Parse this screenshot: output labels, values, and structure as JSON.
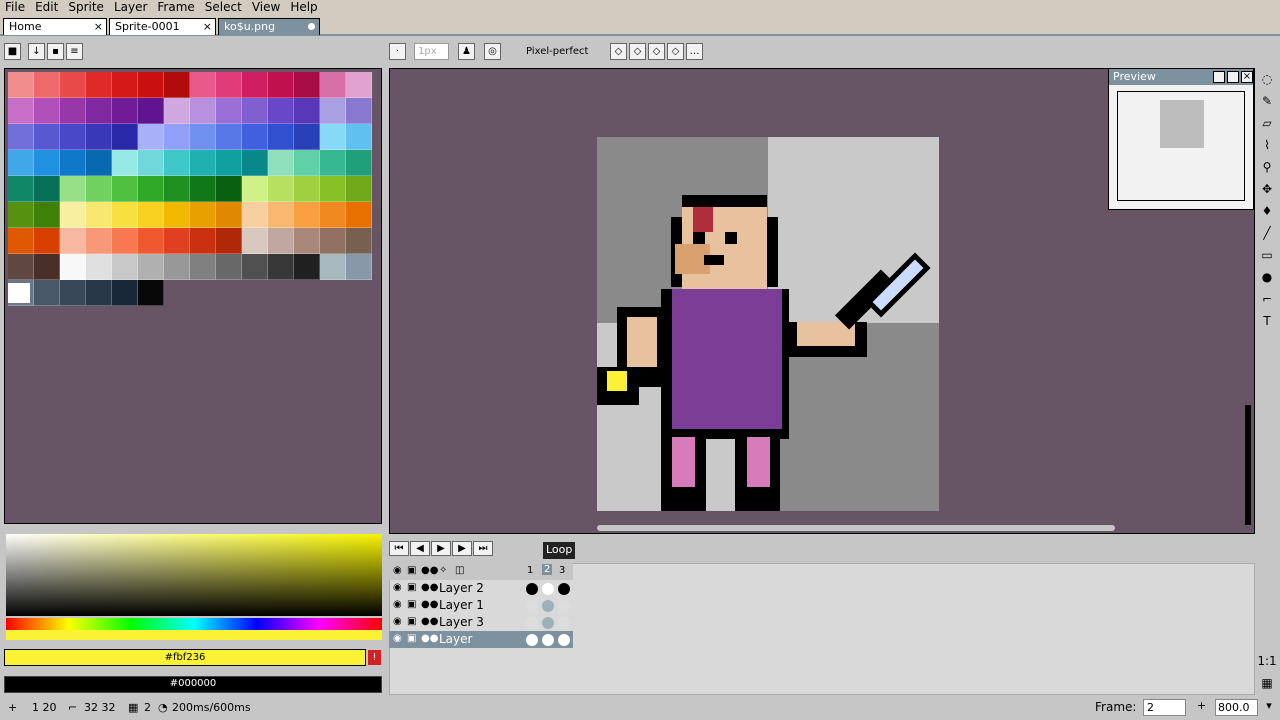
{
  "menu": [
    "File",
    "Edit",
    "Sprite",
    "Layer",
    "Frame",
    "Select",
    "View",
    "Help"
  ],
  "tabs": [
    {
      "label": "Home",
      "close": "×"
    },
    {
      "label": "Sprite-0001",
      "close": "×"
    },
    {
      "label": "ko$u.png"
    }
  ],
  "toolbar": {
    "brush_size": "1px",
    "pixel_perfect_label": "Pixel-perfect"
  },
  "preview": {
    "title": "Preview"
  },
  "animation": {
    "loop_tooltip": "Loop"
  },
  "timeline": {
    "frames": [
      "1",
      "2",
      "3"
    ],
    "layers": [
      {
        "name": "Layer 2"
      },
      {
        "name": "Layer 1"
      },
      {
        "name": "Layer 3"
      },
      {
        "name": "Layer"
      }
    ]
  },
  "colors": {
    "foreground_hex": "#fbf236",
    "background_hex": "#000000",
    "foreground": "#fbf236",
    "background": "#000000"
  },
  "status": {
    "position": "1 20",
    "size": "32 32",
    "frame_info": "2",
    "duration": "200ms/600ms",
    "frame_label": "Frame:",
    "frame_value": "2",
    "zoom": "800.0"
  },
  "palette": [
    "#f08c8c",
    "#ee6a6a",
    "#e84a4a",
    "#e02a2a",
    "#d41818",
    "#c81010",
    "#b00c0c",
    "#e85a8a",
    "#e03a78",
    "#d01e62",
    "#c0104e",
    "#a80c44",
    "#d870a8",
    "#e0a0d0",
    "#c870c8",
    "#b050b8",
    "#9838a8",
    "#8028a0",
    "#701c98",
    "#601490",
    "#d0a8e0",
    "#b890e0",
    "#9870d8",
    "#8060d0",
    "#6848c8",
    "#5838b8",
    "#a8a0e0",
    "#8878d0",
    "#7070d8",
    "#5858d0",
    "#4848c8",
    "#3838b8",
    "#2828a8",
    "#a8b0f8",
    "#90a0f8",
    "#7090f0",
    "#5878e8",
    "#4060e0",
    "#3050d0",
    "#2840b8",
    "#88d8f8",
    "#60c0f0",
    "#40a8e8",
    "#2090e0",
    "#1078c8",
    "#0868b0",
    "#98e8e8",
    "#70d8d8",
    "#40c8c8",
    "#20b0b0",
    "#10a0a0",
    "#088888",
    "#90e0c0",
    "#60d0a8",
    "#38b890",
    "#20a078",
    "#108868",
    "#087058",
    "#98e088",
    "#70d060",
    "#50c040",
    "#30a828",
    "#209020",
    "#107818",
    "#086010",
    "#d0f088",
    "#b8e060",
    "#a0d040",
    "#88c028",
    "#70a818",
    "#589010",
    "#408008",
    "#f8f0a0",
    "#f8e870",
    "#f8e040",
    "#f8d020",
    "#f0b800",
    "#e8a000",
    "#e08800",
    "#f8d0a0",
    "#f8b870",
    "#f8a040",
    "#f08820",
    "#e87000",
    "#e05800",
    "#d84000",
    "#f8b8a0",
    "#f89878",
    "#f87850",
    "#f05830",
    "#e04020",
    "#c83010",
    "#b02808",
    "#d8c8c0",
    "#c0a8a0",
    "#a88878",
    "#907060",
    "#786050",
    "#604840",
    "#483028",
    "#f8f8f8",
    "#e0e0e0",
    "#c8c8c8",
    "#b0b0b0",
    "#989898",
    "#808080",
    "#686868",
    "#505050",
    "#383838",
    "#202020",
    "#a8b8c0",
    "#8898a8",
    "#687888",
    "#485868",
    "#384858",
    "#283848",
    "#182838",
    "#080808"
  ]
}
